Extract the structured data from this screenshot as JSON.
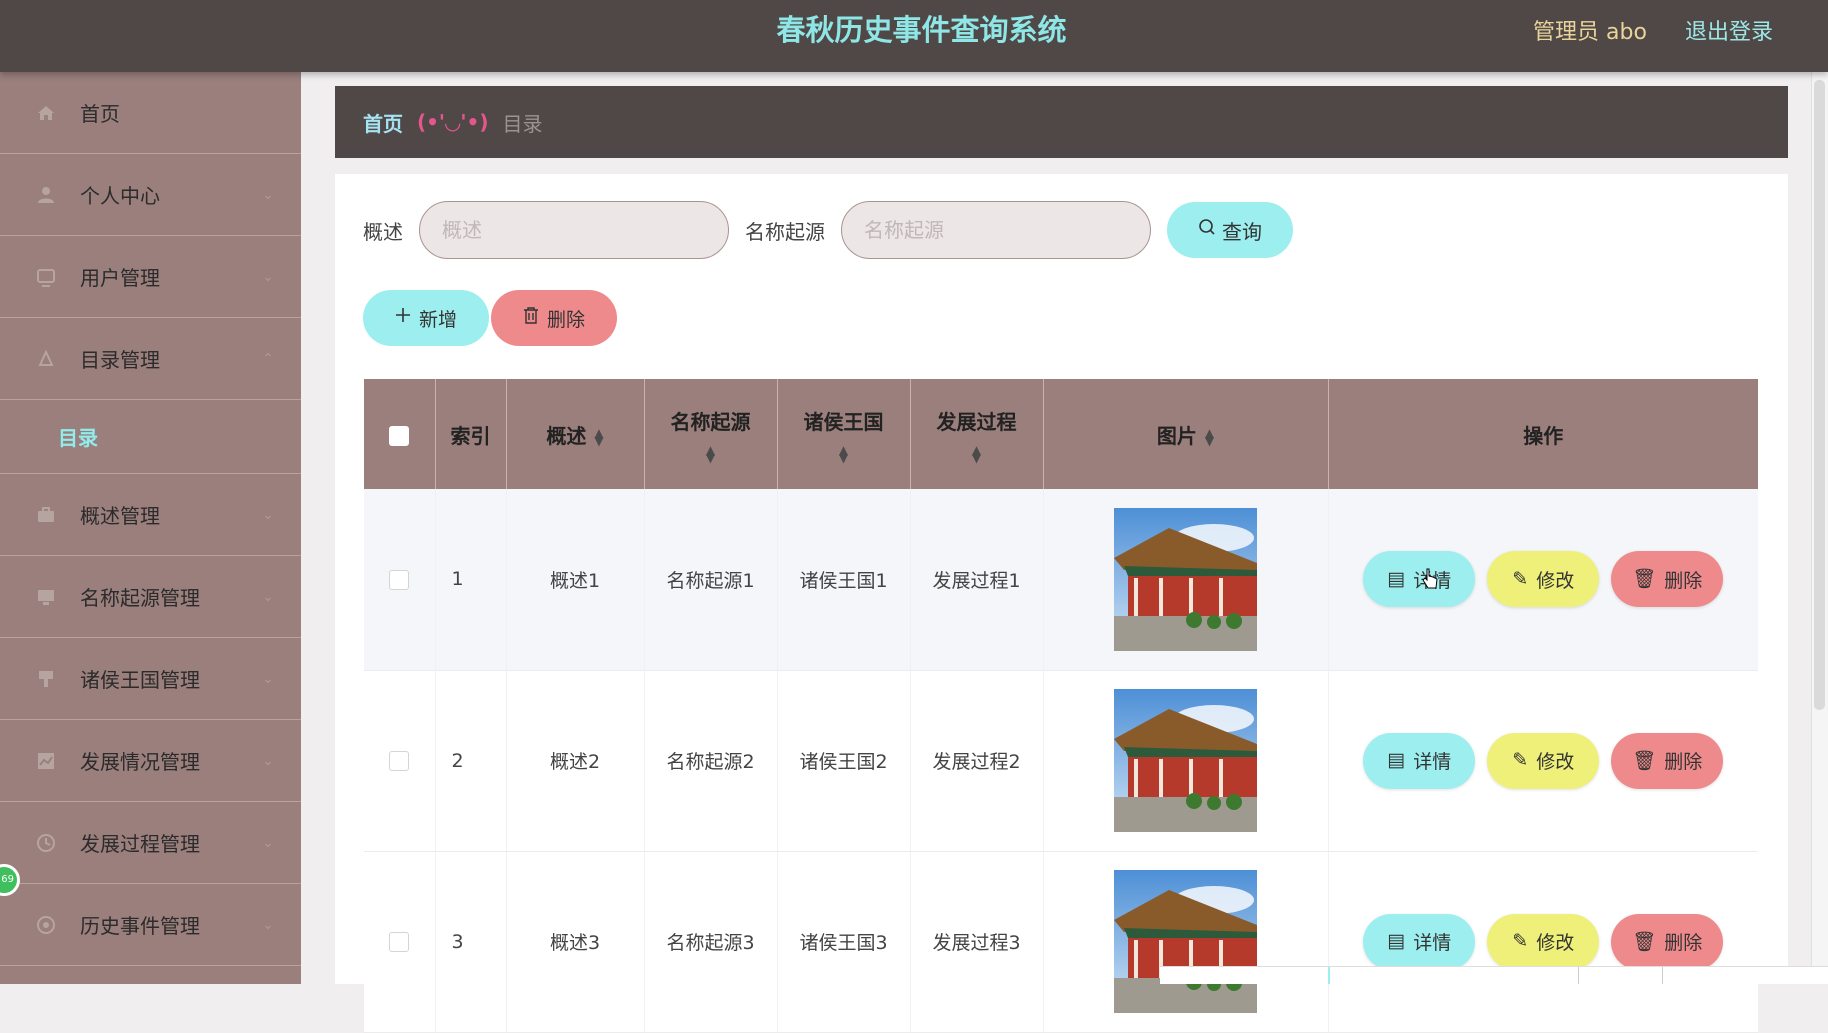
{
  "header": {
    "title": "春秋历史事件查询系统",
    "admin": "管理员 abo",
    "logout": "退出登录"
  },
  "sidebar": {
    "items": [
      {
        "label": "首页",
        "icon": "home-icon"
      },
      {
        "label": "个人中心",
        "icon": "user-icon"
      },
      {
        "label": "用户管理",
        "icon": "users-icon"
      },
      {
        "label": "目录管理",
        "icon": "catalog-icon"
      },
      {
        "label": "目录",
        "icon": ""
      },
      {
        "label": "概述管理",
        "icon": "briefcase-icon"
      },
      {
        "label": "名称起源管理",
        "icon": "monitor-icon"
      },
      {
        "label": "诸侯王国管理",
        "icon": "flag-icon"
      },
      {
        "label": "发展情况管理",
        "icon": "chart-icon"
      },
      {
        "label": "发展过程管理",
        "icon": "clock-icon"
      },
      {
        "label": "历史事件管理",
        "icon": "circle-icon"
      }
    ],
    "badge": "69"
  },
  "breadcrumb": {
    "home": "首页",
    "separator": "(•'◡'•)",
    "current": "目录"
  },
  "search": {
    "overview_label": "概述",
    "overview_placeholder": "概述",
    "origin_label": "名称起源",
    "origin_placeholder": "名称起源",
    "query_button": "查询"
  },
  "actions": {
    "add": "新增",
    "delete": "删除"
  },
  "table": {
    "columns": [
      "索引",
      "概述",
      "名称起源",
      "诸侯王国",
      "发展过程",
      "图片",
      "操作"
    ],
    "rows": [
      {
        "index": "1",
        "overview": "概述1",
        "origin": "名称起源1",
        "kingdom": "诸侯王国1",
        "process": "发展过程1"
      },
      {
        "index": "2",
        "overview": "概述2",
        "origin": "名称起源2",
        "kingdom": "诸侯王国2",
        "process": "发展过程2"
      },
      {
        "index": "3",
        "overview": "概述3",
        "origin": "名称起源3",
        "kingdom": "诸侯王国3",
        "process": "发展过程3"
      }
    ],
    "row_buttons": {
      "detail": "详情",
      "edit": "修改",
      "delete": "删除"
    }
  },
  "colors": {
    "header_bg": "#4f4847",
    "sidebar_bg": "#9a7f7c",
    "accent_cyan": "#9deeee",
    "accent_yellow": "#eef07a",
    "accent_red": "#ee8a8b"
  }
}
